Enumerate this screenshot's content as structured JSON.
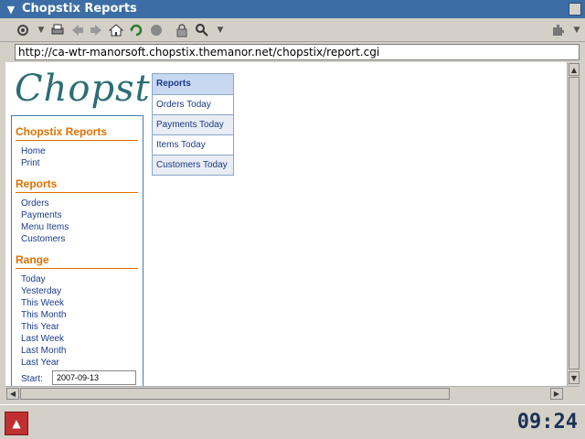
{
  "window": {
    "title": "Chopstix Reports"
  },
  "toolbar": {
    "icons": [
      "settings-icon",
      "print-icon",
      "back-icon",
      "forward-icon",
      "home-icon",
      "reload-icon",
      "stop-icon",
      "lock-icon",
      "search-icon"
    ]
  },
  "address": {
    "url": "http://ca-wtr-manorsoft.chopstix.themanor.net/chopstix/report.cgi"
  },
  "page": {
    "logo": "ChopstiX",
    "sections": {
      "chopstix": {
        "title": "Chopstix Reports",
        "links": [
          "Home",
          "Print"
        ]
      },
      "reports": {
        "title": "Reports",
        "links": [
          "Orders",
          "Payments",
          "Menu Items",
          "Customers"
        ]
      },
      "range": {
        "title": "Range",
        "links": [
          "Today",
          "Yesterday",
          "This Week",
          "This Month",
          "This Year",
          "Last Week",
          "Last Month",
          "Last Year"
        ]
      }
    },
    "start": {
      "label": "Start:",
      "value": "2007-09-13"
    },
    "reports_menu": {
      "header": "Reports",
      "items": [
        "Orders Today",
        "Payments Today",
        "Items Today",
        "Customers Today"
      ]
    }
  },
  "taskbar": {
    "clock": "09:24"
  }
}
